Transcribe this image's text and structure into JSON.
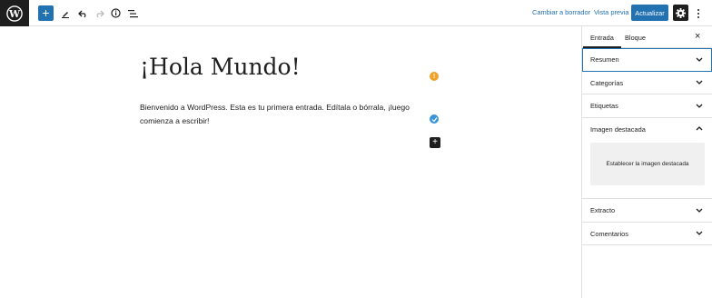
{
  "topbar": {
    "logo_icon": "wordpress-icon",
    "add_icon": "plus-icon",
    "tools_icon": "pencil-icon",
    "undo_icon": "undo-icon",
    "redo_icon": "redo-icon",
    "details_icon": "info-icon",
    "outline_icon": "list-view-icon",
    "switch_draft_label": "Cambiar a borrador",
    "preview_label": "Vista previa",
    "update_label": "Actualizar",
    "settings_icon": "gear-icon",
    "more_icon": "more-vertical-icon"
  },
  "editor": {
    "title": "¡Hola Mundo!",
    "paragraph": "Bienvenido a WordPress. Esta es tu primera entrada. Edítala o bórrala, ¡luego comienza a escribir!",
    "warning_badge": "!",
    "status_icon": "check-icon",
    "inserter_icon": "plus-icon"
  },
  "sidebar": {
    "tabs": [
      {
        "label": "Entrada",
        "active": true
      },
      {
        "label": "Bloque",
        "active": false
      }
    ],
    "close_icon": "close-icon",
    "panels": {
      "summary": "Resumen",
      "categories": "Categorías",
      "tags": "Etiquetas",
      "featured_image": "Imagen destacada",
      "featured_image_button": "Establecer la imagen destacada",
      "excerpt": "Extracto",
      "comments": "Comentarios"
    }
  },
  "colors": {
    "accent": "#2271b1",
    "dark": "#1e1e1e",
    "warning": "#f0a32a",
    "ok": "#3a93d6"
  }
}
